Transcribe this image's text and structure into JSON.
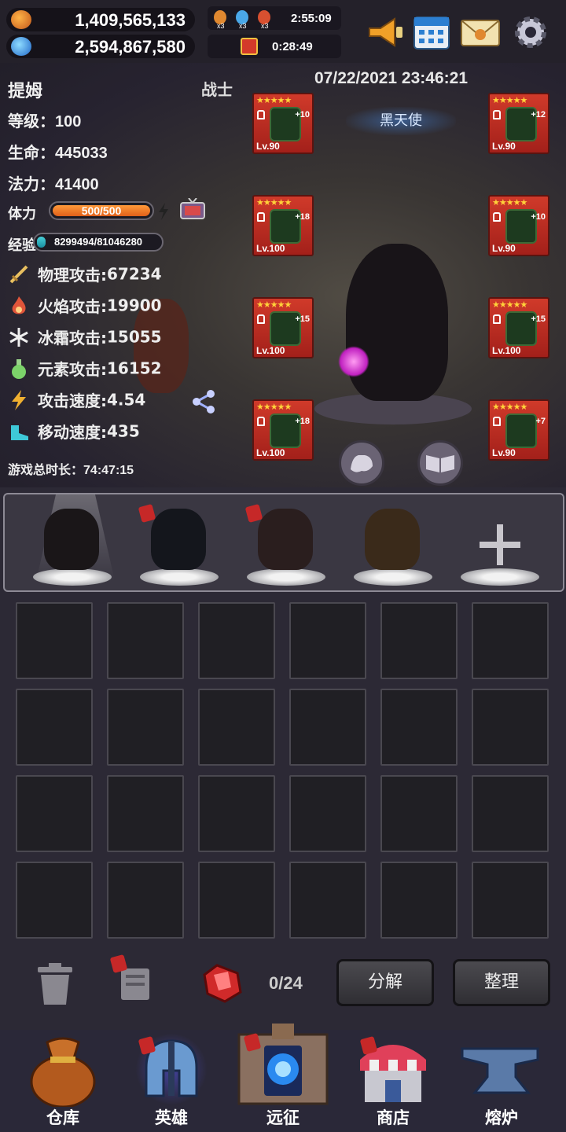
{
  "resources": {
    "gold": "1,409,565,133",
    "gems": "2,594,867,580"
  },
  "timers": {
    "main": "2:55:09",
    "gift": "0:28:49",
    "buff_counts": [
      "x3",
      "x3",
      "x3"
    ]
  },
  "top_buttons": [
    "megaphone-icon",
    "calendar-icon",
    "mail-icon",
    "gear-icon"
  ],
  "hero": {
    "name": "提姆",
    "class": "战士",
    "datetime": "07/22/2021 23:46:21",
    "title_badge": "黑天使",
    "level_label": "等级：",
    "level": "100",
    "hp_label": "生命：",
    "hp": "445033",
    "mp_label": "法力：",
    "mp": "41400",
    "stamina_label": "体力",
    "stamina": "500/500",
    "stamina_fraction": 1.0,
    "exp_label": "经验",
    "exp": "8299494/81046280",
    "exp_fraction": 0.102,
    "attributes": [
      {
        "icon": "sword-icon",
        "label": "物理攻击:",
        "value": "67234",
        "color": "#e8c060"
      },
      {
        "icon": "fire-icon",
        "label": "火焰攻击:",
        "value": "19900",
        "color": "#e0553a"
      },
      {
        "icon": "snowflake-icon",
        "label": "冰霜攻击:",
        "value": "15055",
        "color": "#e8e8f0"
      },
      {
        "icon": "potion-icon",
        "label": "元素攻击:",
        "value": "16152",
        "color": "#7cd36a"
      },
      {
        "icon": "lightning-icon",
        "label": "攻击速度:",
        "value": "4.54",
        "color": "#f0b030"
      },
      {
        "icon": "boot-icon",
        "label": "移动速度:",
        "value": "435",
        "color": "#3ec8d8"
      }
    ],
    "playtime_label": "游戏总时长：",
    "playtime": "74:47:15"
  },
  "equipment_left": [
    {
      "stars": "★★★★★",
      "plus": "+10",
      "level": "Lv.90",
      "slot": "helmet"
    },
    {
      "stars": "★★★★★",
      "plus": "+18",
      "level": "Lv.100",
      "slot": "necklace"
    },
    {
      "stars": "★★★★★",
      "plus": "+15",
      "level": "Lv.100",
      "slot": "gloves"
    },
    {
      "stars": "★★★★★",
      "plus": "+18",
      "level": "Lv.100",
      "slot": "weapon"
    }
  ],
  "equipment_right": [
    {
      "stars": "★★★★★",
      "plus": "+12",
      "level": "Lv.90",
      "slot": "ring"
    },
    {
      "stars": "★★★★★",
      "plus": "+10",
      "level": "Lv.90",
      "slot": "armor"
    },
    {
      "stars": "★★★★★",
      "plus": "+15",
      "level": "Lv.100",
      "slot": "boots"
    },
    {
      "stars": "★★★★★",
      "plus": "+7",
      "level": "Lv.90",
      "slot": "shield"
    }
  ],
  "inventory": {
    "count": "0/24",
    "decompose": "分解",
    "sort": "整理"
  },
  "nav": [
    {
      "label": "仓库",
      "icon": "bag-icon"
    },
    {
      "label": "英雄",
      "icon": "helmet-icon"
    },
    {
      "label": "远征",
      "icon": "portal-icon"
    },
    {
      "label": "商店",
      "icon": "shop-icon"
    },
    {
      "label": "熔炉",
      "icon": "anvil-icon"
    }
  ]
}
